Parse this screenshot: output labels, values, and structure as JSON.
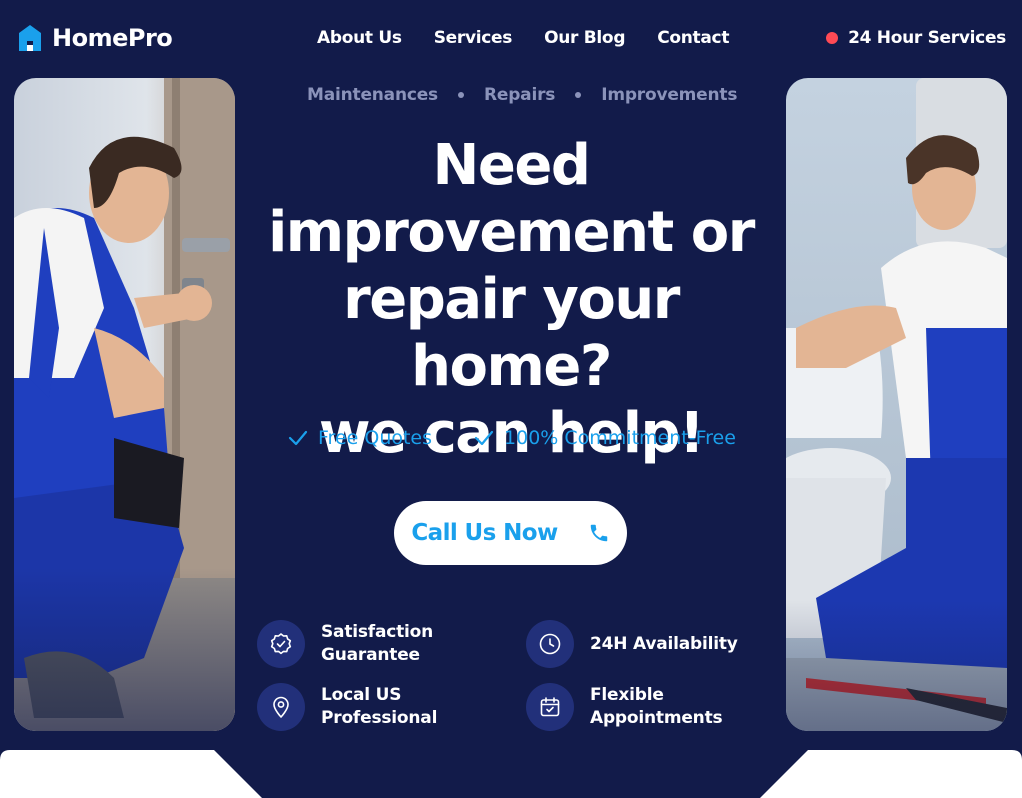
{
  "brand": {
    "name": "HomePro",
    "accent": "#1aa0ec",
    "background": "#121b4a",
    "alert_dot": "#ff4a55"
  },
  "nav": {
    "items": [
      {
        "label": "About Us"
      },
      {
        "label": "Services"
      },
      {
        "label": "Our Blog"
      },
      {
        "label": "Contact"
      }
    ]
  },
  "header": {
    "hours_label": "24 Hour Services",
    "logo_icon": "house-icon"
  },
  "hero": {
    "categories": [
      "Maintenances",
      "Repairs",
      "Improvements"
    ],
    "headline_line1": "Need",
    "headline_line2": "improvement or",
    "headline_line3": "repair your home?",
    "headline_line4": "we can help!",
    "checks": [
      {
        "label": "Free Quotes",
        "icon": "checkmark-icon"
      },
      {
        "label": "100% Commitment-Free",
        "icon": "checkmark-icon"
      }
    ],
    "cta_label": "Call Us Now",
    "cta_icon": "phone-icon"
  },
  "features": [
    {
      "line1": "Satisfaction",
      "line2": "Guarantee",
      "icon": "badge-check-icon"
    },
    {
      "line1": "24H Availability",
      "line2": "",
      "icon": "clock-icon"
    },
    {
      "line1": "Local US",
      "line2": "Professional",
      "icon": "location-pin-icon"
    },
    {
      "line1": "Flexible",
      "line2": "Appointments",
      "icon": "calendar-check-icon"
    }
  ]
}
